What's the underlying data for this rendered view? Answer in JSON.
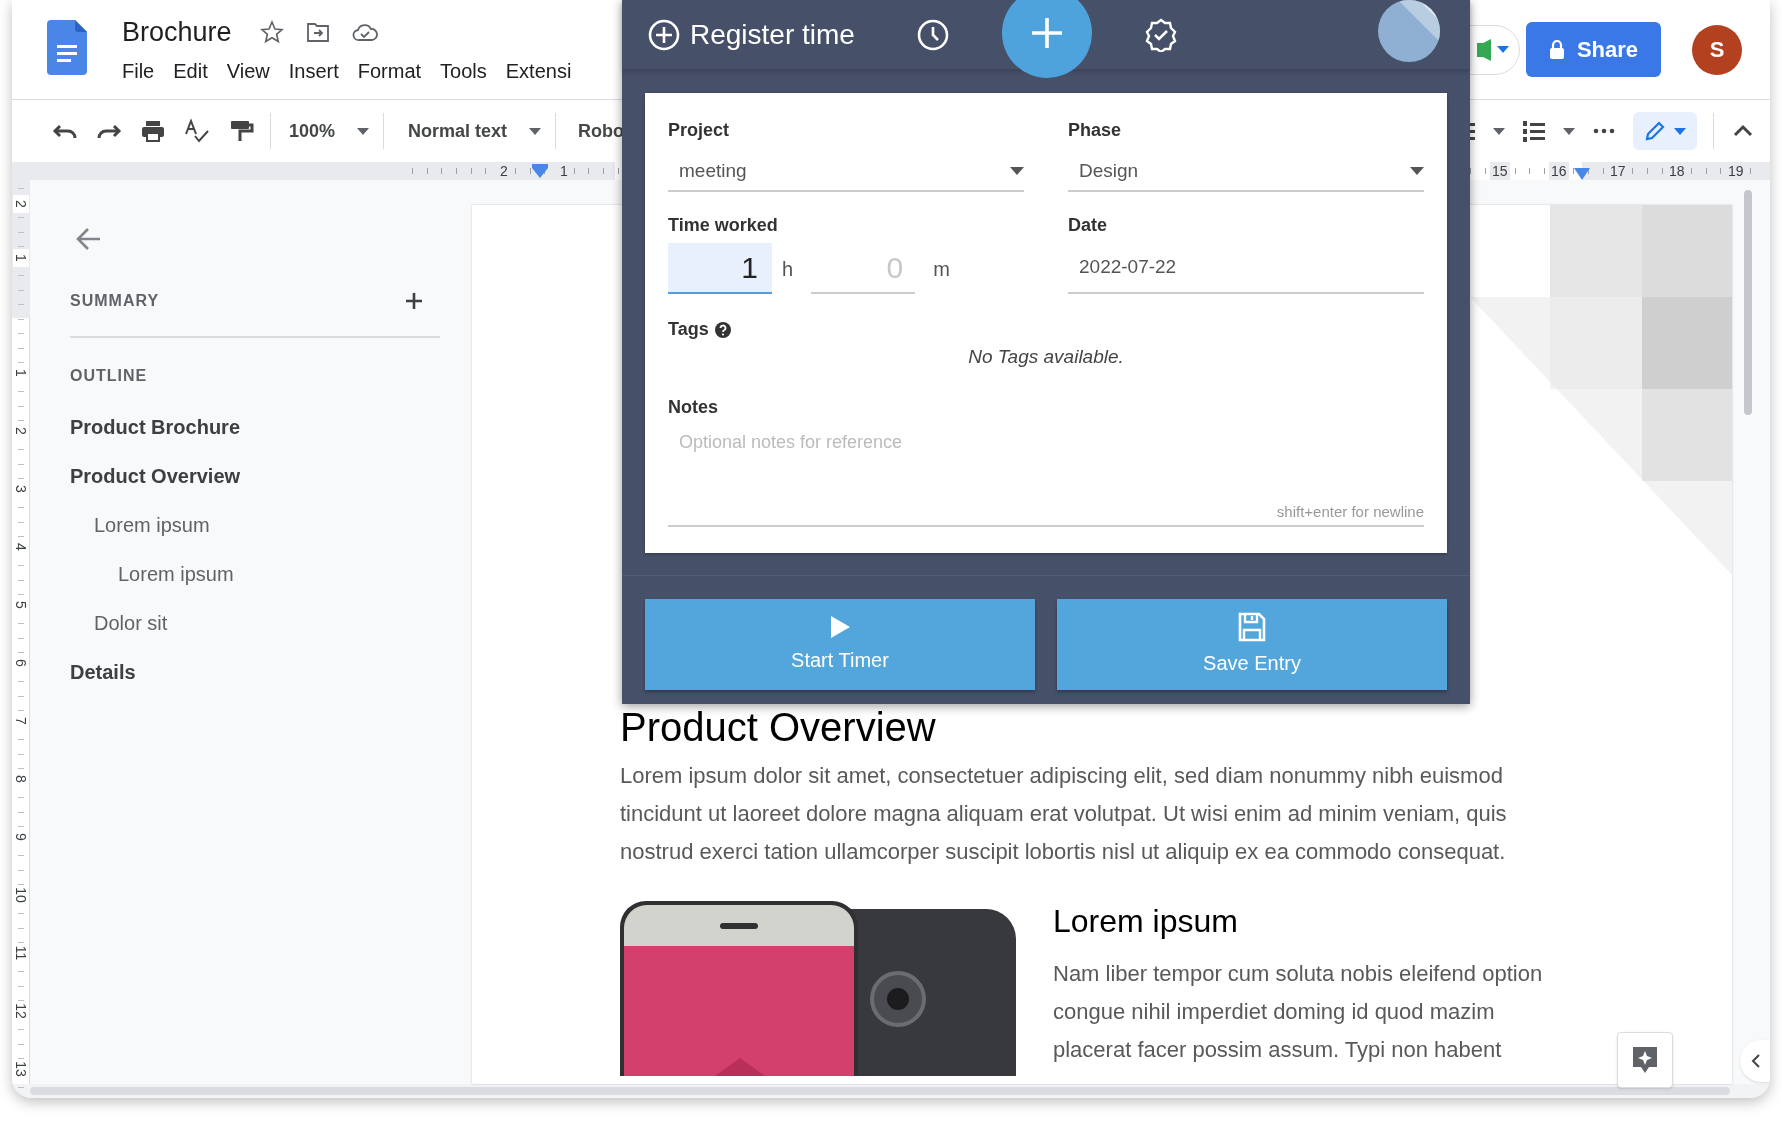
{
  "document_title": "Brochure",
  "menu": [
    "File",
    "Edit",
    "View",
    "Insert",
    "Format",
    "Tools",
    "Extensi"
  ],
  "toolbar": {
    "zoom": "100%",
    "text_style": "Normal text",
    "font": "Robo"
  },
  "share_button": "Share",
  "account_initial": "S",
  "ruler": {
    "horizontal": [
      "2",
      "1",
      "15",
      "16",
      "17",
      "18",
      "19"
    ],
    "vertical": [
      "2",
      "1",
      "1",
      "2",
      "3",
      "4",
      "5",
      "6",
      "7",
      "8",
      "9",
      "10",
      "11",
      "12",
      "13"
    ]
  },
  "sidebar": {
    "summary_heading": "SUMMARY",
    "outline_heading": "OUTLINE",
    "outline": [
      {
        "label": "Product Brochure"
      },
      {
        "label": "Product Overview",
        "children": [
          {
            "label": "Lorem ipsum",
            "children": [
              {
                "label": "Lorem ipsum"
              }
            ]
          },
          {
            "label": "Dolor sit"
          }
        ]
      },
      {
        "label": "Details"
      }
    ]
  },
  "page": {
    "heading": "Product Overview",
    "paragraph": "Lorem ipsum dolor sit amet, consectetuer adipiscing elit, sed diam nonummy nibh euismod tincidunt ut laoreet dolore magna aliquam erat volutpat. Ut wisi enim ad minim veniam, quis nostrud exerci tation ullamcorper suscipit lobortis nisl ut aliquip ex ea commodo consequat.",
    "subheading": "Lorem ipsum",
    "paragraph_2": "Nam liber tempor cum soluta nobis eleifend option congue nihil imperdiet doming id quod mazim placerat facer possim assum. Typi non habent"
  },
  "popup": {
    "title": "Register time",
    "project": {
      "label": "Project",
      "value": "meeting"
    },
    "phase": {
      "label": "Phase",
      "value": "Design"
    },
    "time_worked": {
      "label": "Time worked",
      "hours": "1",
      "hours_unit": "h",
      "minutes_placeholder": "0",
      "minutes_unit": "m"
    },
    "date": {
      "label": "Date",
      "value": "2022-07-22"
    },
    "tags": {
      "label": "Tags",
      "empty_message": "No Tags available."
    },
    "notes": {
      "label": "Notes",
      "placeholder": "Optional notes for reference",
      "hint": "shift+enter for newline"
    },
    "buttons": [
      {
        "kind": "play",
        "label": "Start Timer"
      },
      {
        "kind": "save",
        "label": "Save Entry"
      }
    ]
  }
}
